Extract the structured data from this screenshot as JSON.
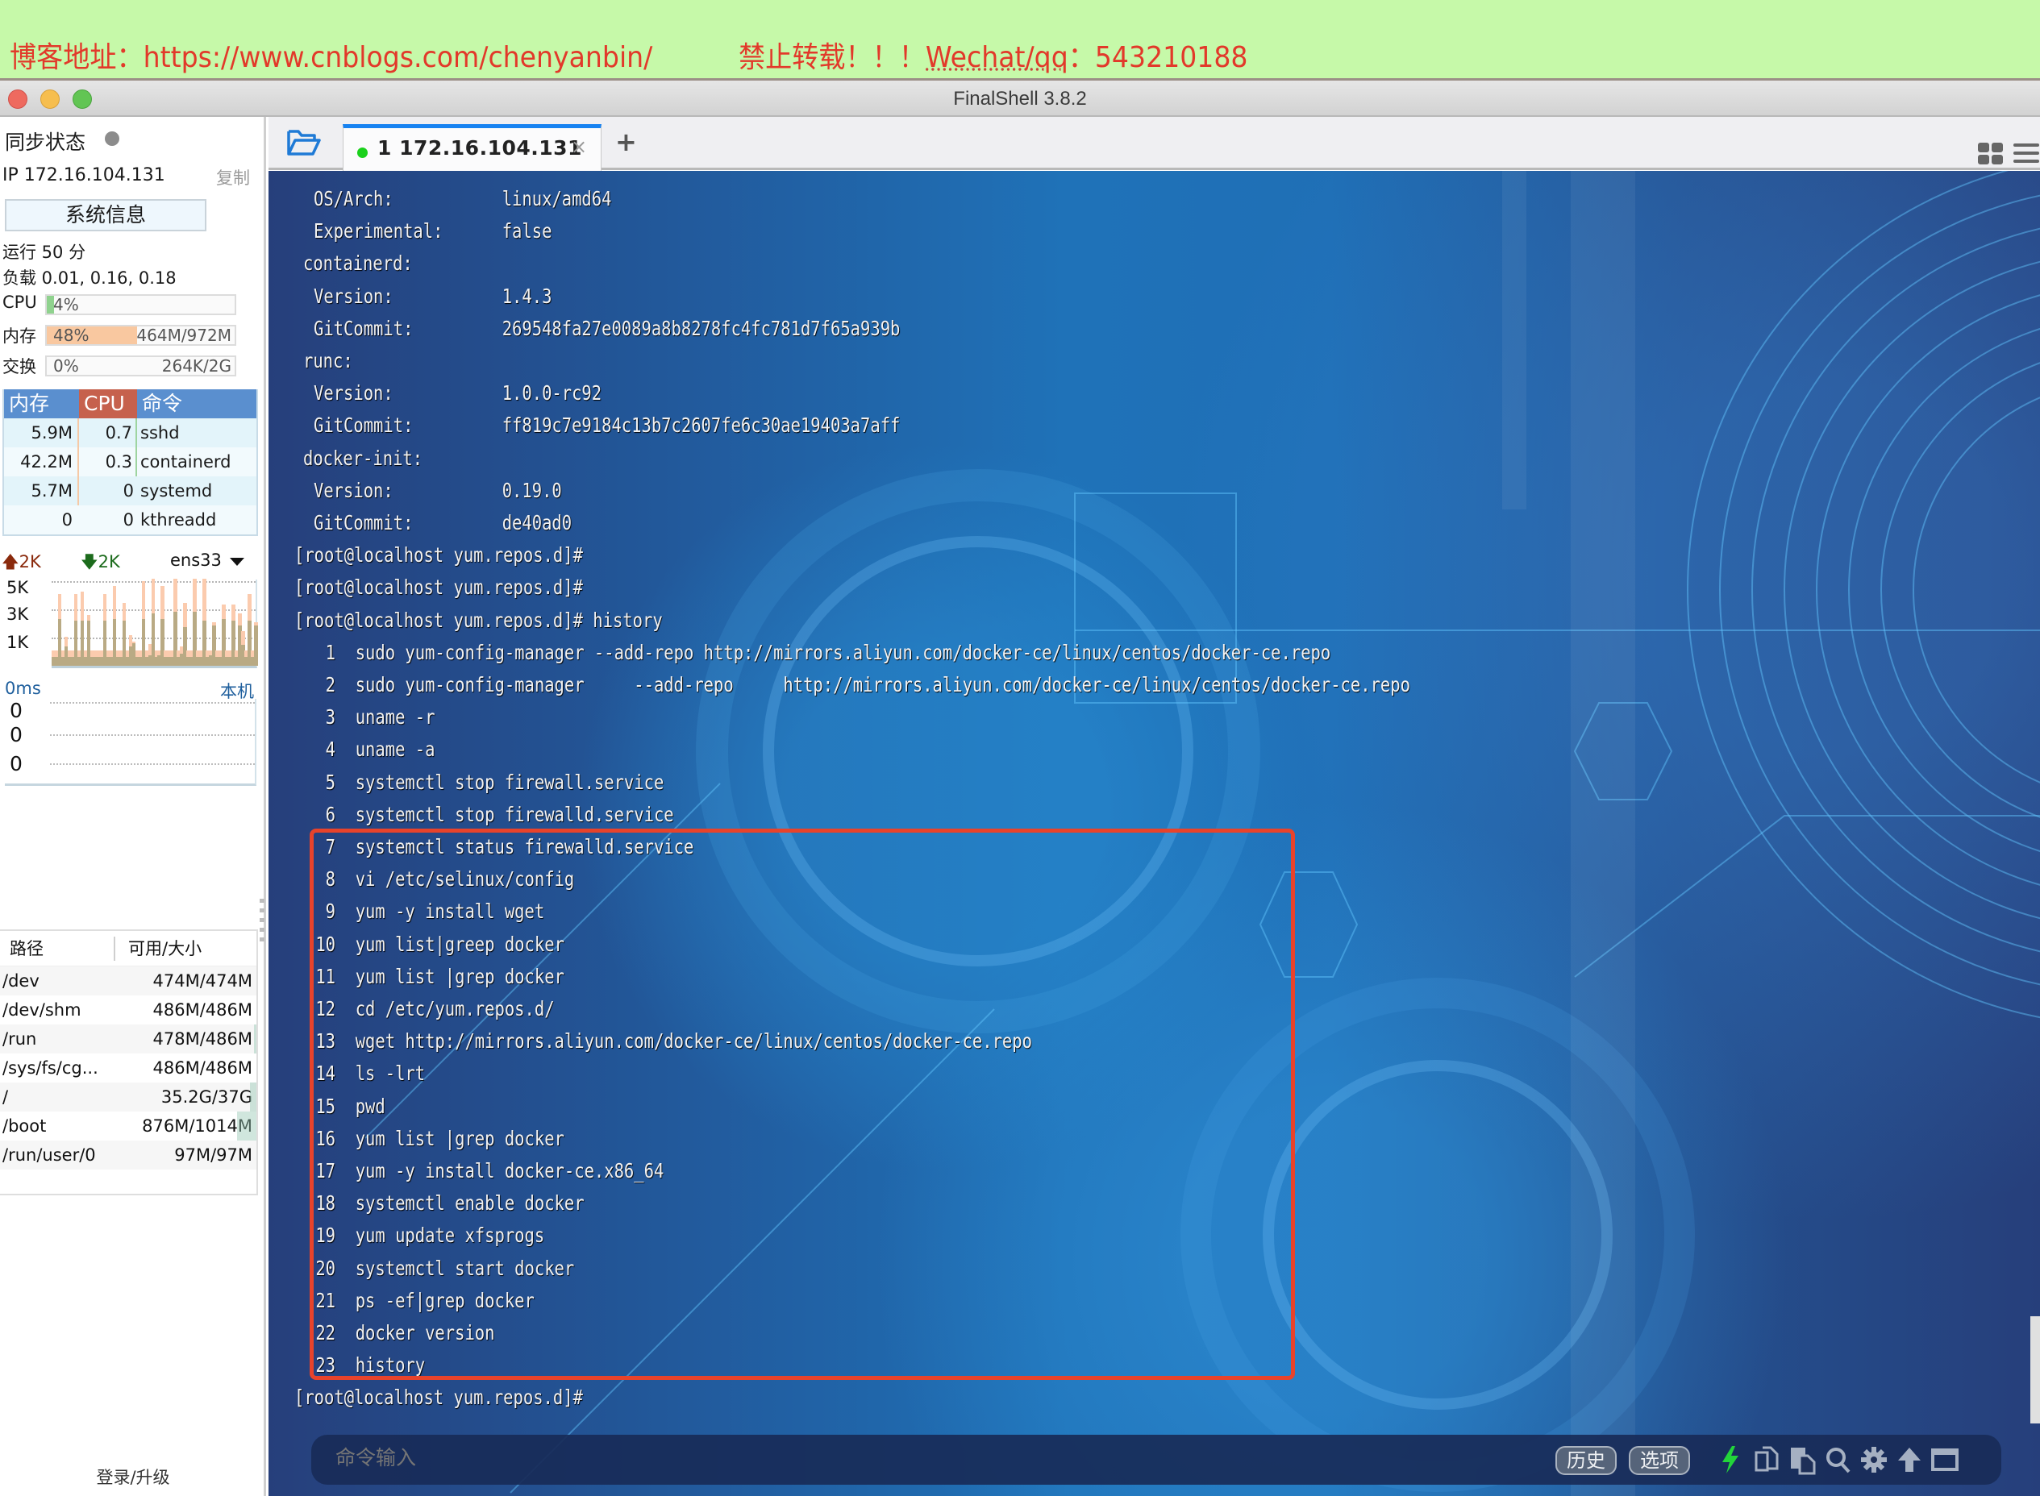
{
  "banner": {
    "blog_text": "博客地址：https://www.cnblogs.com/chenyanbin/",
    "notice_prefix": "禁止转载！！！",
    "notice_contact": "Wechat/qq",
    "notice_suffix": "：543210188"
  },
  "window": {
    "title": "FinalShell 3.8.2"
  },
  "sidebar": {
    "sync_label": "同步状态",
    "ip_text": "IP 172.16.104.131",
    "copy_label": "复制",
    "sysinfo_button": "系统信息",
    "uptime": "运行 50 分",
    "load": "负载 0.01, 0.16, 0.18",
    "meters": [
      {
        "label": "CPU",
        "percent_text": "4%",
        "amount": "",
        "fraction": 0.04,
        "color": "#8fd28e"
      },
      {
        "label": "内存",
        "percent_text": "48%",
        "amount": "464M/972M",
        "fraction": 0.48,
        "color": "#f9c8a0"
      },
      {
        "label": "交换",
        "percent_text": "0%",
        "amount": "264K/2G",
        "fraction": 0.0,
        "color": "#cfcfcf"
      }
    ],
    "process_table": {
      "headers": [
        "内存",
        "CPU",
        "命令"
      ],
      "rows": [
        {
          "mem": "5.9M",
          "cpu": "0.7",
          "cmd": "sshd"
        },
        {
          "mem": "42.2M",
          "cpu": "0.3",
          "cmd": "containerd"
        },
        {
          "mem": "5.7M",
          "cpu": "0",
          "cmd": "systemd"
        },
        {
          "mem": "0",
          "cpu": "0",
          "cmd": "kthreadd"
        }
      ]
    },
    "network": {
      "upload": "2K",
      "download": "2K",
      "interface": "ens33",
      "y_labels": [
        "5K",
        "3K",
        "1K"
      ],
      "up_series": [
        0.18,
        0.18,
        0.82,
        0.18,
        0.33,
        0.18,
        0.18,
        0.82,
        0.18,
        0.85,
        0.18,
        0.58,
        0.18,
        0.18,
        0.18,
        0.18,
        0.82,
        0.18,
        0.18,
        0.92,
        0.18,
        0.18,
        0.72,
        0.18,
        0.35,
        0.28,
        0.18,
        0.18,
        0.97,
        0.18,
        0.25,
        1.0,
        0.18,
        0.18,
        0.92,
        0.18,
        0.18,
        0.18,
        1.0,
        0.18,
        0.22,
        0.72,
        0.18,
        0.18,
        1.0,
        0.18,
        0.18,
        1.0,
        0.18,
        0.18,
        0.5,
        0.18,
        0.18,
        0.7,
        0.18,
        0.18,
        0.7,
        0.18,
        0.6,
        0.4,
        0.18,
        0.82,
        0.18,
        0.5
      ],
      "down_series": [
        0.1,
        0.1,
        0.54,
        0.1,
        0.22,
        0.1,
        0.1,
        0.52,
        0.1,
        0.52,
        0.1,
        0.52,
        0.1,
        0.1,
        0.1,
        0.1,
        0.52,
        0.1,
        0.1,
        0.54,
        0.1,
        0.1,
        0.52,
        0.1,
        0.22,
        0.26,
        0.1,
        0.1,
        0.54,
        0.1,
        0.12,
        0.6,
        0.1,
        0.12,
        0.54,
        0.1,
        0.1,
        0.1,
        0.62,
        0.1,
        0.14,
        0.44,
        0.1,
        0.1,
        0.62,
        0.1,
        0.1,
        0.52,
        0.1,
        0.12,
        0.46,
        0.1,
        0.1,
        0.54,
        0.1,
        0.1,
        0.52,
        0.1,
        0.46,
        0.24,
        0.1,
        0.52,
        0.1,
        0.46
      ]
    },
    "ping": {
      "label": "0ms",
      "host": "本机",
      "values": [
        "0",
        "0",
        "0"
      ]
    },
    "disk_table": {
      "headers": [
        "路径",
        "可用/大小"
      ],
      "rows": [
        {
          "path": "/dev",
          "size": "474M/474M",
          "used_fraction": 0.0
        },
        {
          "path": "/dev/shm",
          "size": "486M/486M",
          "used_fraction": 0.0
        },
        {
          "path": "/run",
          "size": "478M/486M",
          "used_fraction": 0.02
        },
        {
          "path": "/sys/fs/cg...",
          "size": "486M/486M",
          "used_fraction": 0.0
        },
        {
          "path": "/",
          "size": "35.2G/37G",
          "used_fraction": 0.05
        },
        {
          "path": "/boot",
          "size": "876M/1014M",
          "used_fraction": 0.14
        },
        {
          "path": "/run/user/0",
          "size": "97M/97M",
          "used_fraction": 0.0
        }
      ]
    },
    "login_label": "登录/升级"
  },
  "tabs": {
    "items": [
      {
        "label": "1  172.16.104.131",
        "status": "connected",
        "status_color": "#1bd11c"
      }
    ],
    "close_glyph": "×",
    "add_glyph": "+"
  },
  "terminal": {
    "lines": [
      {
        "indent": 1,
        "text": "OS/Arch:",
        "value": "linux/amd64"
      },
      {
        "indent": 1,
        "text": "Experimental:",
        "value": "false"
      },
      {
        "indent": 0,
        "text": "containerd:",
        "value": ""
      },
      {
        "indent": 1,
        "text": "Version:",
        "value": "1.4.3"
      },
      {
        "indent": 1,
        "text": "GitCommit:",
        "value": "269548fa27e0089a8b8278fc4fc781d7f65a939b"
      },
      {
        "indent": 0,
        "text": "runc:",
        "value": ""
      },
      {
        "indent": 1,
        "text": "Version:",
        "value": "1.0.0-rc92"
      },
      {
        "indent": 1,
        "text": "GitCommit:",
        "value": "ff819c7e9184c13b7c2607fe6c30ae19403a7aff"
      },
      {
        "indent": 0,
        "text": "docker-init:",
        "value": ""
      },
      {
        "indent": 1,
        "text": "Version:",
        "value": "0.19.0"
      },
      {
        "indent": 1,
        "text": "GitCommit:",
        "value": "de40ad0"
      }
    ],
    "prompt": "[root@localhost yum.repos.d]#",
    "history_command": "history",
    "history": [
      "sudo yum-config-manager --add-repo http://mirrors.aliyun.com/docker-ce/linux/centos/docker-ce.repo",
      "sudo yum-config-manager     --add-repo     http://mirrors.aliyun.com/docker-ce/linux/centos/docker-ce.repo",
      "uname -r",
      "uname -a",
      "systemctl stop firewall.service",
      "systemctl stop firewalld.service",
      "systemctl status firewalld.service",
      "vi /etc/selinux/config",
      "yum -y install wget",
      "yum list|greep docker",
      "yum list |grep docker",
      "cd /etc/yum.repos.d/",
      "wget http://mirrors.aliyun.com/docker-ce/linux/centos/docker-ce.repo",
      "ls -lrt",
      "pwd",
      "yum list |grep docker",
      "yum -y install docker-ce.x86_64",
      "systemctl enable docker",
      "yum update xfsprogs",
      "systemctl start docker",
      "ps -ef|grep docker",
      "docker version",
      "history"
    ],
    "highlight": {
      "from_entry": 7,
      "to_entry": 23,
      "color": "#e8432b"
    }
  },
  "command_bar": {
    "placeholder": "命令输入",
    "history_button": "历史",
    "options_button": "选项",
    "icons": [
      "lightning-icon",
      "copy-icon",
      "paste-icon",
      "search-icon",
      "gear-icon",
      "upload-arrow-icon",
      "window-icon"
    ]
  }
}
